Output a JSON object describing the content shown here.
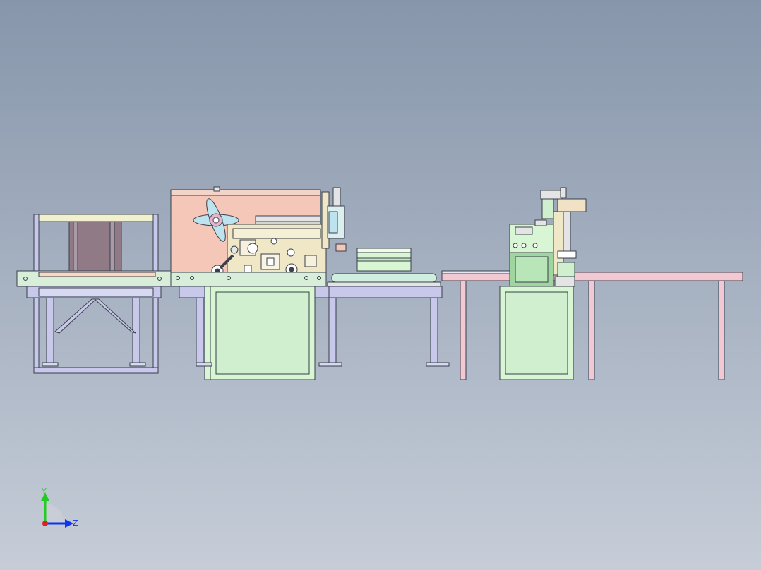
{
  "viewport": {
    "background_top": "#8796ab",
    "background_bottom": "#c6cdd8"
  },
  "triad": {
    "y_label": "Y",
    "z_label": "Z",
    "y_color": "#22cc22",
    "z_color": "#1133ee",
    "x_color": "#dd2222"
  },
  "colors": {
    "outline": "#3a3f4a",
    "frame_lavender": "#c7c8ea",
    "frame_pink": "#f2c9d2",
    "machine_salmon": "#f5c7b8",
    "machine_cream": "#efe7c6",
    "machine_green": "#cfefcf",
    "box_mauve": "#8f7a86",
    "roller_green": "#cfeedd",
    "pale_green": "#d8f5d4",
    "pale_yellow": "#f1f0cf"
  }
}
